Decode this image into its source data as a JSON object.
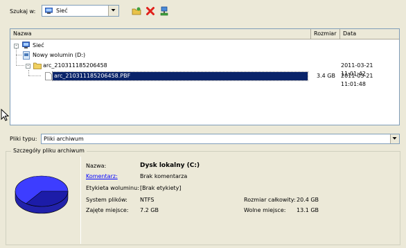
{
  "toolbar": {
    "lookin_label": "Szukaj w:",
    "lookin_value": "Sieć"
  },
  "list": {
    "columns": [
      "Nazwa",
      "Rozmiar",
      "Data"
    ],
    "rows": [
      {
        "name": "Sieć",
        "size": "",
        "date": ""
      },
      {
        "name": "Nowy wolumin (D:)",
        "size": "",
        "date": ""
      },
      {
        "name": "arc_210311185206458",
        "size": "",
        "date": "2011-03-21 11:01:42"
      },
      {
        "name": "arc_210311185206458.PBF",
        "size": "3.4 GB",
        "date": "2011-03-21 11:01:48"
      }
    ]
  },
  "filetype": {
    "label": "Pliki typu:",
    "value": "Pliki archiwum"
  },
  "details": {
    "legend": "Szczegóły pliku archiwum",
    "name_label": "Nazwa:",
    "name_value": "Dysk lokalny (C:)",
    "comment_label": "Komentarz:",
    "comment_value": "Brak komentarza",
    "volume_label": "Etykieta woluminu:",
    "volume_value": "[Brak etykiety]",
    "fs_label": "System plików:",
    "fs_value": "NTFS",
    "used_label": "Zajęte miejsce:",
    "used_value": "7.2 GB",
    "total_label": "Rozmiar całkowity:",
    "total_value": "20.4 GB",
    "free_label": "Wolne miejsce:",
    "free_value": "13.1 GB",
    "used_fraction": 0.35
  },
  "colors": {
    "selection": "#0a246a",
    "pie_free": "#3a3aff",
    "pie_used": "#1a1a99"
  }
}
